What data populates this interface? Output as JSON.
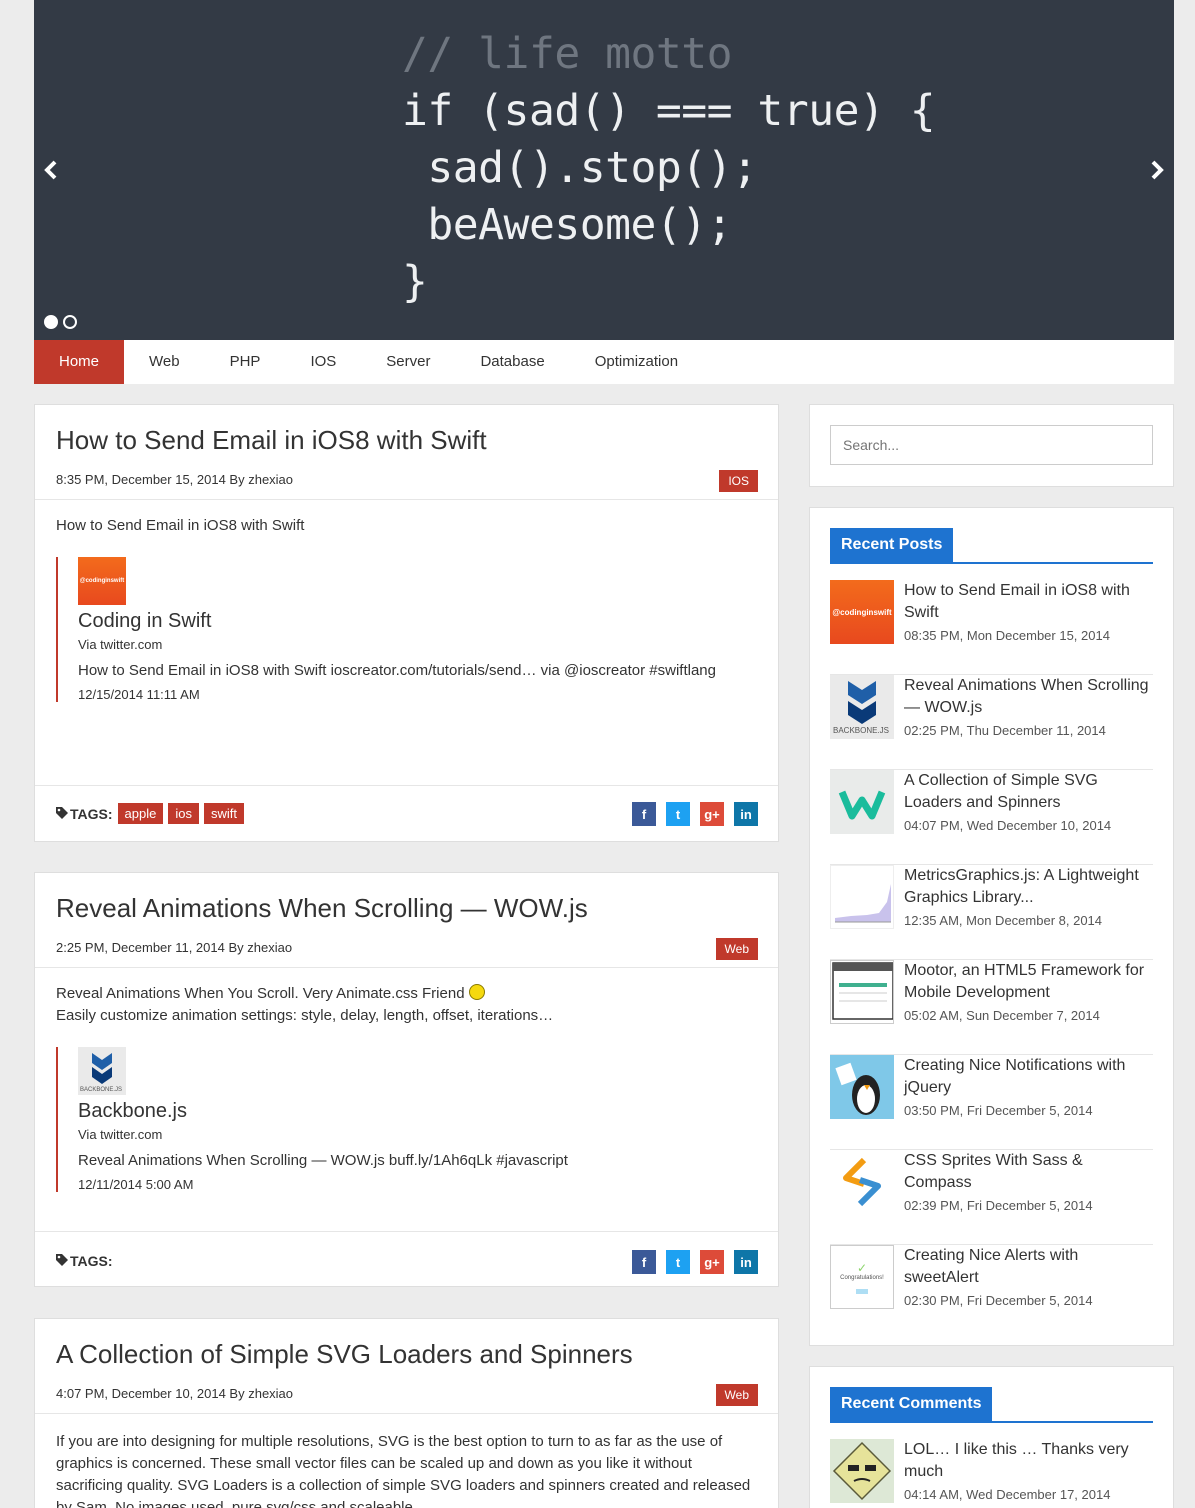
{
  "hero": {
    "code_lines": [
      "// life motto",
      "if (sad() === true) {",
      " sad().stop();",
      " beAwesome();",
      "}"
    ],
    "prev_arrow": "‹",
    "next_arrow": "›"
  },
  "nav": {
    "items": [
      {
        "label": "Home",
        "active": true
      },
      {
        "label": "Web"
      },
      {
        "label": "PHP"
      },
      {
        "label": "IOS"
      },
      {
        "label": "Server"
      },
      {
        "label": "Database"
      },
      {
        "label": "Optimization"
      }
    ]
  },
  "posts": [
    {
      "title": "How to Send Email in iOS8 with Swift",
      "meta": "8:35 PM, December 15, 2014 By zhexiao",
      "category": "IOS",
      "excerpt": "How to Send Email in iOS8 with Swift",
      "quote": {
        "avatar_text": "@codinginswift",
        "name": "Coding in Swift",
        "via": "Via twitter.com",
        "text": "How to Send Email in iOS8 with Swift ioscreator.com/tutorials/send… via @ioscreator #swiftlang",
        "date": "12/15/2014 11:11 AM"
      },
      "tags_label": "TAGS:",
      "tags": [
        "apple",
        "ios",
        "swift"
      ]
    },
    {
      "title": "Reveal Animations When Scrolling — WOW.js",
      "meta": "2:25 PM, December 11, 2014 By zhexiao",
      "category": "Web",
      "excerpt_line1": "Reveal Animations When You Scroll. Very Animate.css Friend",
      "excerpt_line2": "Easily customize animation settings: style, delay, length, offset, iterations…",
      "quote": {
        "avatar_text": "BACKBONE.JS",
        "name": "Backbone.js",
        "via": "Via twitter.com",
        "text": "Reveal Animations When Scrolling — WOW.js buff.ly/1Ah6qLk #javascript",
        "date": "12/11/2014 5:00 AM"
      },
      "tags_label": "TAGS:"
    },
    {
      "title": "A Collection of Simple SVG Loaders and Spinners",
      "meta": "4:07 PM, December 10, 2014 By zhexiao",
      "category": "Web",
      "excerpt": "If you are into designing for multiple resolutions, SVG is the best option to turn to as far as the use of graphics is concerned. These small vector files can be scaled up and down as you like it without sacrificing quality. SVG Loaders is a collection of simple SVG loaders and spinners created and released by Sam. No images used, pure svg/css and scaleable."
    }
  ],
  "social": {
    "fb": "f",
    "tw": "t",
    "gp": "g+",
    "in": "in"
  },
  "sidebar": {
    "search_placeholder": "Search...",
    "recent_posts_title": "Recent Posts",
    "recent_posts": [
      {
        "title": "How to Send Email in iOS8 with Swift",
        "date": "08:35 PM, Mon December 15, 2014",
        "thumb_text": "@codinginswift"
      },
      {
        "title": "Reveal Animations When Scrolling — WOW.js",
        "date": "02:25 PM, Thu December 11, 2014",
        "thumb_text": "BACKBONE.JS"
      },
      {
        "title": "A Collection of Simple SVG Loaders and Spinners",
        "date": "04:07 PM, Wed December 10, 2014"
      },
      {
        "title": "MetricsGraphics.js: A Lightweight Graphics Library...",
        "date": "12:35 AM, Mon December 8, 2014"
      },
      {
        "title": "Mootor, an HTML5 Framework for Mobile Development",
        "date": "05:02 AM, Sun December 7, 2014"
      },
      {
        "title": "Creating Nice Notifications with jQuery",
        "date": "03:50 PM, Fri December 5, 2014"
      },
      {
        "title": "CSS Sprites With Sass & Compass",
        "date": "02:39 PM, Fri December 5, 2014"
      },
      {
        "title": "Creating Nice Alerts with sweetAlert",
        "date": "02:30 PM, Fri December 5, 2014",
        "thumb_text": "Congratulations!"
      }
    ],
    "recent_comments_title": "Recent Comments",
    "recent_comments": [
      {
        "text": "LOL… I like this … Thanks very much",
        "date": "04:14 AM, Wed December 17, 2014"
      }
    ]
  },
  "colors": {
    "accent_red": "#c0392b",
    "accent_blue": "#1e73d0",
    "hero_bg": "#333a45"
  }
}
